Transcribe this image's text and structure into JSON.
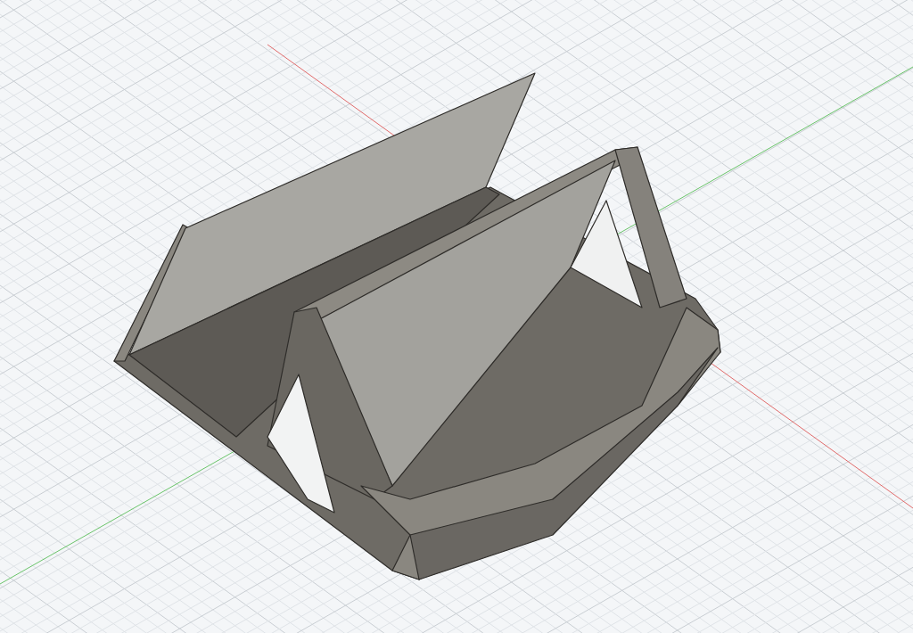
{
  "viewport": {
    "axes": [
      {
        "kind": "x",
        "color": "#e06a6a"
      },
      {
        "kind": "y",
        "color": "#6ac46a"
      }
    ]
  }
}
